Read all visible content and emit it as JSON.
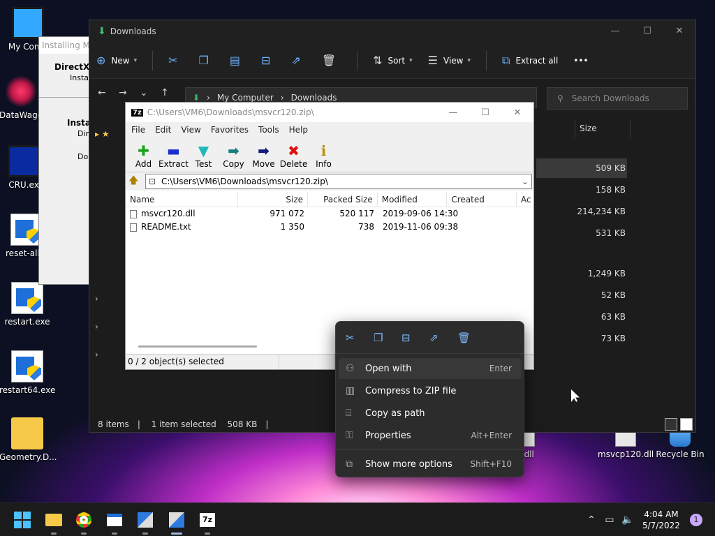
{
  "desktop": {
    "icons": [
      {
        "label": "My Comp"
      },
      {
        "label": "DataWago"
      },
      {
        "label": "CRU.ex"
      },
      {
        "label": "reset-all.e"
      },
      {
        "label": "restart.exe"
      },
      {
        "label": "restart64.exe"
      },
      {
        "label": "Geometry.D..."
      },
      {
        "label": "0.dll"
      },
      {
        "label": "msvcp120.dll"
      },
      {
        "label": "Recycle Bin"
      }
    ]
  },
  "installer": {
    "title": "Installing Mi",
    "heading": "DirectX S",
    "sub": "Install",
    "heading2": "Instal",
    "line1": "Dire",
    "line2": "Do"
  },
  "explorer": {
    "title": "Downloads",
    "toolbar": {
      "new": "New",
      "sort": "Sort",
      "view": "View",
      "extract_all": "Extract all",
      "more": "•••"
    },
    "breadcrumb": [
      "My Computer",
      "Downloads"
    ],
    "search_placeholder": "Search Downloads",
    "size_header": "Size",
    "sizes": [
      "509 KB",
      "158 KB",
      "214,234 KB",
      "531 KB",
      "1,249 KB",
      "52 KB",
      "63 KB",
      "73 KB"
    ],
    "status": {
      "items": "8 items",
      "selected": "1 item selected",
      "size": "508 KB"
    }
  },
  "sevenzip": {
    "title": "C:\\Users\\VM6\\Downloads\\msvcr120.zip\\",
    "logo": "7z",
    "menu": [
      "File",
      "Edit",
      "View",
      "Favorites",
      "Tools",
      "Help"
    ],
    "tools": [
      {
        "label": "Add",
        "glyph": "✚",
        "color": "#1aa31a"
      },
      {
        "label": "Extract",
        "glyph": "▬",
        "color": "#1b2fd0"
      },
      {
        "label": "Test",
        "glyph": "▼",
        "color": "#20b8b8"
      },
      {
        "label": "Copy",
        "glyph": "➡",
        "color": "#168080"
      },
      {
        "label": "Move",
        "glyph": "➡",
        "color": "#14197a"
      },
      {
        "label": "Delete",
        "glyph": "✖",
        "color": "#e01010"
      },
      {
        "label": "Info",
        "glyph": "ℹ",
        "color": "#b89000"
      }
    ],
    "path": "C:\\Users\\VM6\\Downloads\\msvcr120.zip\\",
    "columns": [
      "Name",
      "Size",
      "Packed Size",
      "Modified",
      "Created",
      "Ac"
    ],
    "rows": [
      {
        "name": "msvcr120.dll",
        "size": "971 072",
        "packed": "520 117",
        "modified": "2019-09-06 14:30"
      },
      {
        "name": "README.txt",
        "size": "1 350",
        "packed": "738",
        "modified": "2019-11-06 09:38"
      }
    ],
    "status": "0 / 2 object(s) selected"
  },
  "context_menu": {
    "items": [
      {
        "label": "Open with",
        "shortcut": "Enter"
      },
      {
        "label": "Compress to ZIP file",
        "shortcut": ""
      },
      {
        "label": "Copy as path",
        "shortcut": ""
      },
      {
        "label": "Properties",
        "shortcut": "Alt+Enter"
      },
      {
        "label": "Show more options",
        "shortcut": "Shift+F10"
      }
    ]
  },
  "taskbar": {
    "time": "4:04 AM",
    "date": "5/7/2022",
    "notifications": "1"
  }
}
